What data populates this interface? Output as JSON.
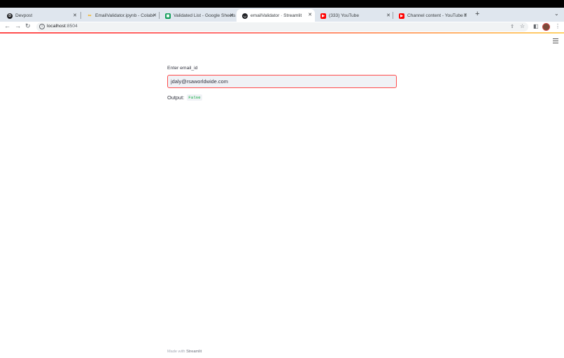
{
  "browser": {
    "tabs": [
      {
        "title": "Devpost",
        "icon": "devpost-icon",
        "color": "#003e54",
        "active": false
      },
      {
        "title": "EmailValidator.ipynb - Colabor",
        "icon": "colab-icon",
        "color": "#f9ab00",
        "active": false
      },
      {
        "title": "Validated List - Google Sheets",
        "icon": "sheets-icon",
        "color": "#0f9d58",
        "active": false
      },
      {
        "title": "emailValidator · Streamlit",
        "icon": "streamlit-icon",
        "color": "#202124",
        "active": true
      },
      {
        "title": "(333) YouTube",
        "icon": "youtube-icon",
        "color": "#ff0000",
        "active": false
      },
      {
        "title": "Channel content - YouTube Stu",
        "icon": "youtube-studio-icon",
        "color": "#ff0000",
        "active": false
      }
    ],
    "url_host": "localhost",
    "url_port": ":8504"
  },
  "form": {
    "label": "Enter email_id",
    "value": "jdaly@rsaworldwide.com"
  },
  "output": {
    "label": "Output:",
    "value": "False"
  },
  "footer": {
    "prefix": "Made with ",
    "brand": "Streamlit"
  },
  "colors": {
    "accent": "#ff4b4b",
    "output_value": "#09ab3b"
  }
}
